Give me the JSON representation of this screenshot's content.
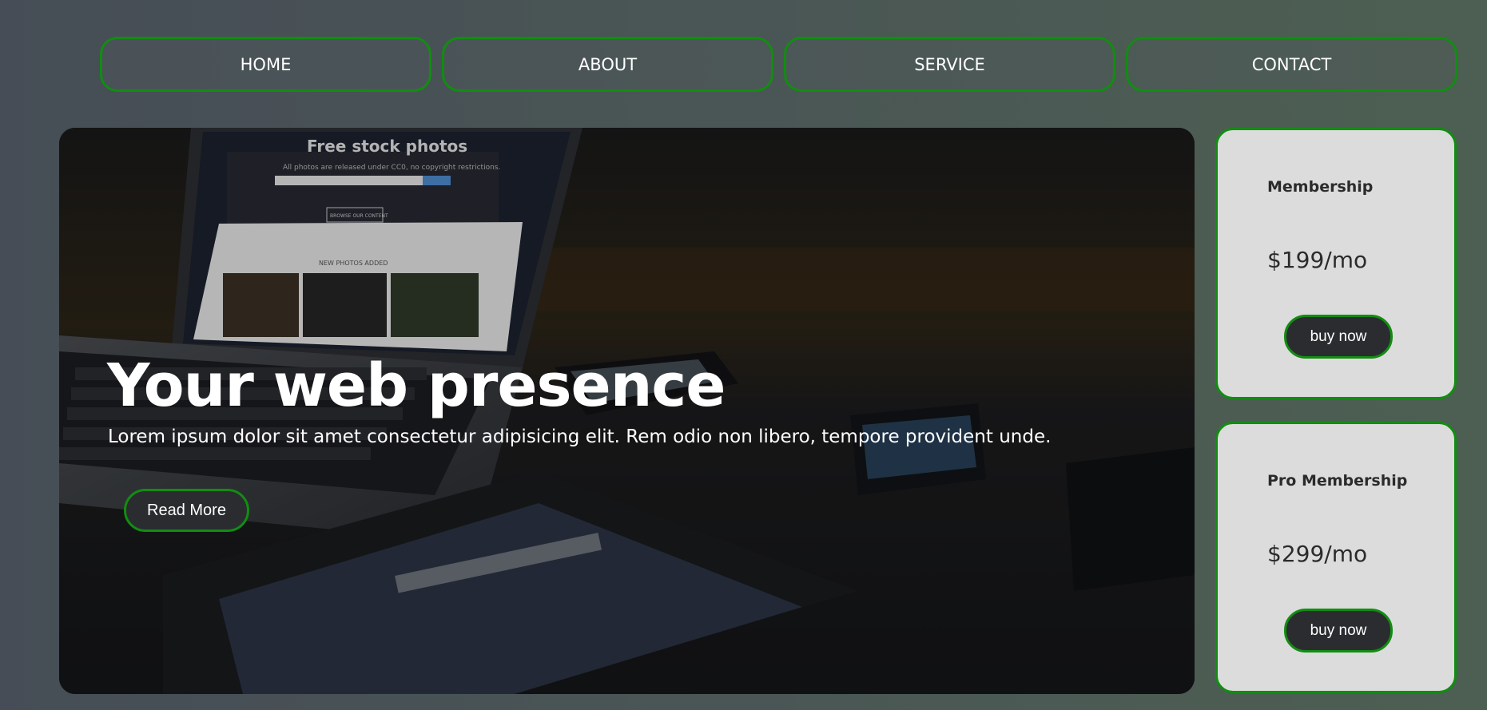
{
  "nav": {
    "items": [
      {
        "label": "HOME"
      },
      {
        "label": "ABOUT"
      },
      {
        "label": "SERVICE"
      },
      {
        "label": "CONTACT"
      }
    ]
  },
  "hero": {
    "title": "Your web presence",
    "text": "Lorem ipsum dolor sit amet consectetur adipisicing elit. Rem odio non libero, tempore provident unde.",
    "button_label": "Read More",
    "image": {
      "screen_title": "Free stock photos",
      "screen_subtitle": "All photos are released under CC0, no copyright restrictions.",
      "screen_button": "BROWSE OUR CONTENT",
      "screen_section": "NEW PHOTOS ADDED"
    }
  },
  "cards": [
    {
      "title": "Membership",
      "price": "$199/mo",
      "button_label": "buy now"
    },
    {
      "title": "Pro Membership",
      "price": "$299/mo",
      "button_label": "buy now"
    }
  ],
  "colors": {
    "accent_border": "#118d11",
    "card_background": "#dcdcdc",
    "button_background": "#2b2c30"
  }
}
